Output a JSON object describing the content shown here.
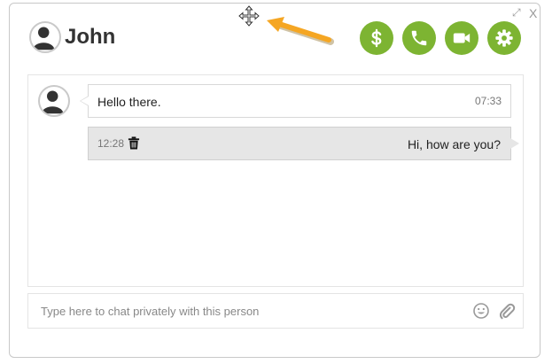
{
  "header": {
    "contact_name": "John",
    "window_controls": {
      "expand_icon": "expand-icon",
      "close_label": "X"
    },
    "move_icon": "move-icon",
    "actions": [
      {
        "name": "payment-button",
        "icon": "dollar-icon"
      },
      {
        "name": "voice-call-button",
        "icon": "phone-icon"
      },
      {
        "name": "video-call-button",
        "icon": "video-camera-icon"
      },
      {
        "name": "settings-button",
        "icon": "gear-icon"
      }
    ]
  },
  "messages": [
    {
      "direction": "incoming",
      "text": "Hello there.",
      "time": "07:33"
    },
    {
      "direction": "outgoing",
      "text": "Hi, how are you?",
      "time": "12:28",
      "delete_icon": "trash-icon"
    }
  ],
  "composer": {
    "placeholder": "Type here to chat privately with this person",
    "value": ""
  },
  "colors": {
    "accent": "#7db432",
    "annotation_arrow": "#f5a623",
    "outgoing_bubble": "#e6e6e6"
  }
}
